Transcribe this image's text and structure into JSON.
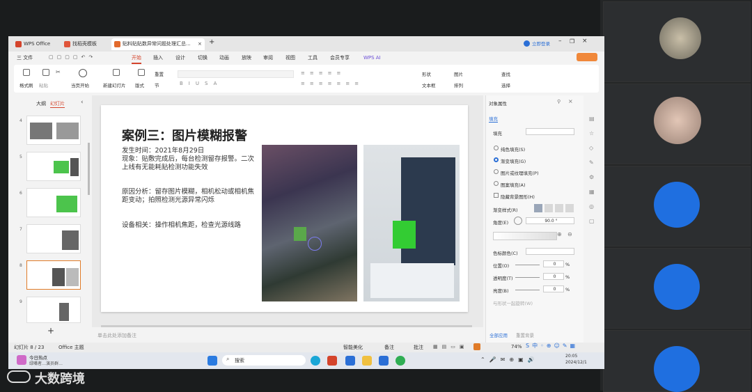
{
  "tabs": [
    {
      "label": "WPS Office"
    },
    {
      "label": "找稻壳模板"
    },
    {
      "label": "贴料贴贴数异常问题处理汇总..."
    }
  ],
  "titlebar": {
    "login_label": "立即登录"
  },
  "menubar": {
    "file": "三 文件",
    "items": [
      "开始",
      "插入",
      "设计",
      "切换",
      "动画",
      "放映",
      "审阅",
      "视图",
      "工具",
      "会员专享"
    ],
    "ai": "WPS AI"
  },
  "ribbon": {
    "format_painter": "格式刷",
    "paste": "粘贴",
    "from_current": "当页开始",
    "new_slide": "新建幻灯片",
    "layout": "版式",
    "section": "节",
    "reset": "重置",
    "shape": "形状",
    "picture": "图片",
    "textbox": "文本框",
    "arrange": "排列",
    "find": "查找",
    "select": "选择"
  },
  "left_panel": {
    "outline_tab": "大纲",
    "slides_tab": "幻灯片",
    "slide_numbers": [
      "4",
      "5",
      "6",
      "7",
      "8",
      "9"
    ]
  },
  "slide": {
    "title": "案例三：图片模糊报警",
    "time": "发生时间：2021年8月29日",
    "phenomenon": "现象：贴敷完成后，每台检测留存报警。二次上线有无能耗贴检测功能失效",
    "cause": "原因分析：留存图片模糊，相机松动或相机焦距变动；拍照检测光源异常闪烁",
    "equipment": "设备相关：操作相机焦距，检查光源线路"
  },
  "notes_placeholder": "单击此处添加备注",
  "right_panel": {
    "title": "对象属性",
    "fill_tab": "填充",
    "fill_section": "填充",
    "options": [
      "纯色填充(S)",
      "渐变填充(G)",
      "图片或纹理填充(P)",
      "图案填充(A)"
    ],
    "hide_bg": "隐藏背景图形(H)",
    "gradient_style": "渐变样式(R)",
    "angle_label": "角度(E)",
    "angle_value": "90.0 °",
    "color_stop": "色标颜色(C)",
    "position_label": "位置(O)",
    "transparency_label": "透明度(T)",
    "brightness_label": "亮度(B)",
    "zero_pct": "0",
    "pct_unit": "%",
    "rotate_with": "与形状一起旋转(W)",
    "apply_all": "全部应用",
    "reset_bg": "重置背景"
  },
  "statusbar": {
    "slide_count": "幻灯片 8 / 23",
    "theme": "Office 主题",
    "smart": "智能美化",
    "notes": "备注",
    "comments": "批注",
    "zoom": "74%"
  },
  "taskbar": {
    "weather_title": "今日热点",
    "weather_sub": "绿嘴者…演员群…",
    "search": "搜索",
    "time": "20:05",
    "date": "2024/12/1"
  },
  "watermark": "大数跨境",
  "colors": {
    "accent_red": "#d4442c",
    "selected_orange": "#e07b28",
    "radio_blue": "#2b6fd6",
    "green_patch": "#33cc33"
  }
}
